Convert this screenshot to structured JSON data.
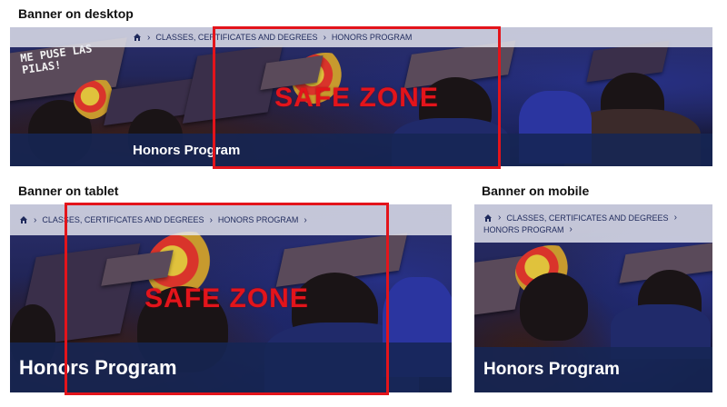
{
  "labels": {
    "desktop": "Banner on desktop",
    "tablet": "Banner on tablet",
    "mobile": "Banner on mobile"
  },
  "breadcrumb": {
    "home_icon": "home-icon",
    "items": [
      "CLASSES, CERTIFICATES AND DEGREES",
      "HONORS PROGRAM"
    ],
    "mobile_items": [
      "CLASSES, CERTIFICATES AND DEGREES",
      "HONORS PROGRAM"
    ]
  },
  "banner_title": "Honors Program",
  "safe_zone_text": "SAFE ZONE",
  "cap_text": "ME PUSE LAS PILAS!",
  "colors": {
    "safe_zone": "#e3141b",
    "title_band": "#162654",
    "breadcrumb_bg": "#e6e8f0",
    "breadcrumb_text": "#1f2a5c"
  }
}
